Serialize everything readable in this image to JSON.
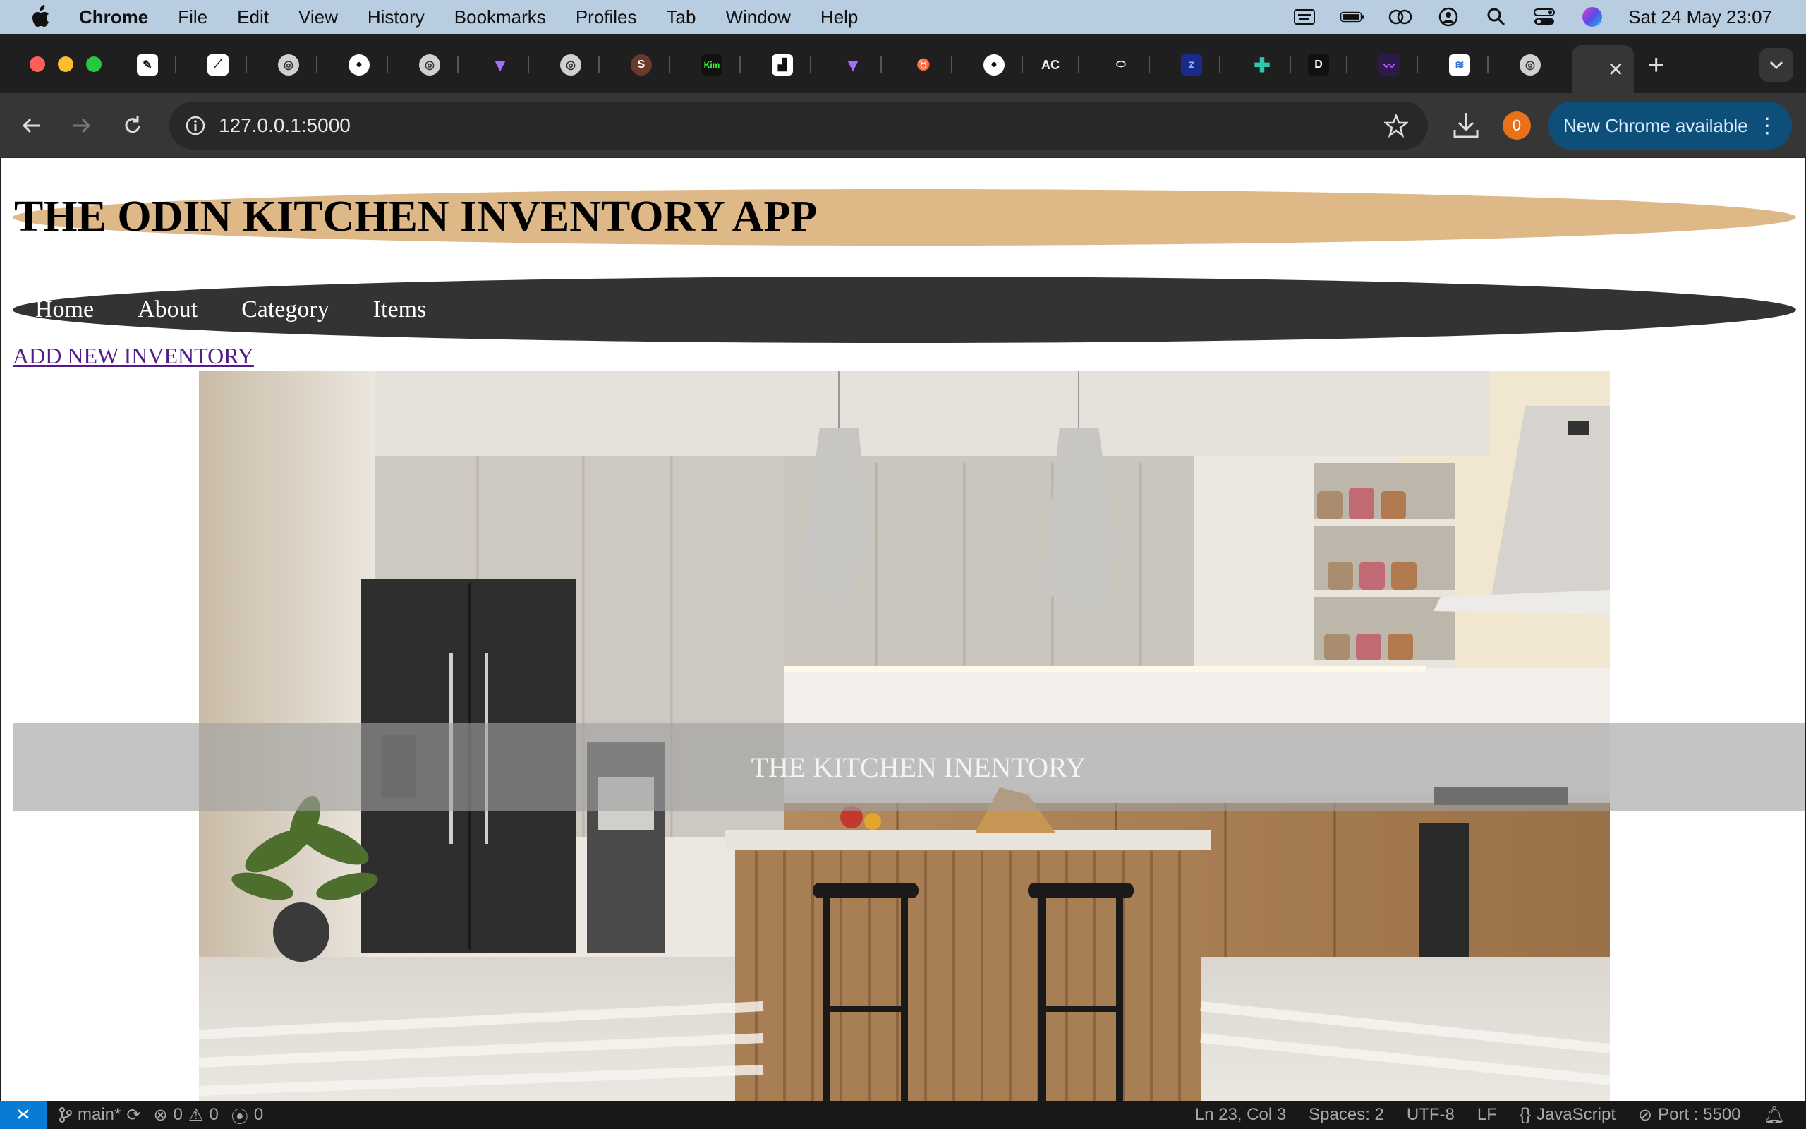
{
  "menubar": {
    "items": [
      "Chrome",
      "File",
      "Edit",
      "View",
      "History",
      "Bookmarks",
      "Profiles",
      "Tab",
      "Window",
      "Help"
    ],
    "clock": "Sat 24 May  23:07"
  },
  "browser": {
    "url": "127.0.0.1:5000",
    "download_badge": "0",
    "update_label": "New Chrome available"
  },
  "page": {
    "title": "THE ODIN KITCHEN INVENTORY APP",
    "nav": [
      "Home",
      "About",
      "Category",
      "Items"
    ],
    "add_link": "ADD NEW INVENTORY",
    "hero_caption": "THE KITCHEN INENTORY"
  },
  "statusbar": {
    "branch": "main*",
    "errors": "0",
    "warnings": "0",
    "ports": "0",
    "position": "Ln 23, Col 3",
    "spaces": "Spaces: 2",
    "encoding": "UTF-8",
    "eol": "LF",
    "language": "JavaScript",
    "port": "Port : 5500"
  }
}
